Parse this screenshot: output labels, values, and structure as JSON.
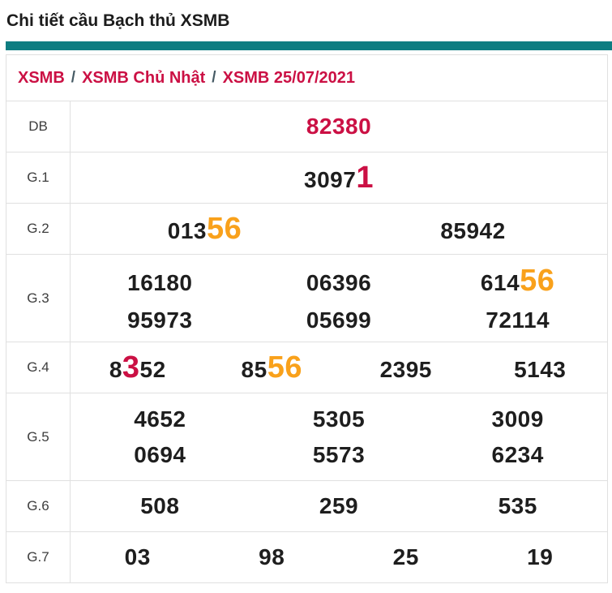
{
  "page": {
    "title": "Chi tiết cầu Bạch thủ XSMB"
  },
  "breadcrumb": {
    "separator": "/",
    "items": [
      {
        "label": "XSMB"
      },
      {
        "label": "XSMB Chủ Nhật"
      },
      {
        "label": "XSMB 25/07/2021"
      }
    ]
  },
  "colors": {
    "accent_teal": "#0e7d81",
    "crimson": "#cb1044",
    "orange": "#f9a11b",
    "text_dark": "#1e1e1e",
    "label_gray": "#3d3d3d",
    "border": "#e0e0e0",
    "separator_gray": "#455a64"
  },
  "results_table": {
    "rows": [
      {
        "label": "DB",
        "lines": [
          [
            [
              {
                "t": "82380",
                "c": "crimson"
              }
            ]
          ]
        ]
      },
      {
        "label": "G.1",
        "lines": [
          [
            [
              {
                "t": "3097"
              },
              {
                "t": "1",
                "c": "crimson",
                "big": true
              }
            ]
          ]
        ]
      },
      {
        "label": "G.2",
        "lines": [
          [
            [
              {
                "t": "013"
              },
              {
                "t": "56",
                "c": "orange",
                "big": true
              }
            ],
            [
              {
                "t": "85942"
              }
            ]
          ]
        ]
      },
      {
        "label": "G.3",
        "lines": [
          [
            [
              {
                "t": "16180"
              }
            ],
            [
              {
                "t": "06396"
              }
            ],
            [
              {
                "t": "614"
              },
              {
                "t": "56",
                "c": "orange",
                "big": true
              }
            ]
          ],
          [
            [
              {
                "t": "95973"
              }
            ],
            [
              {
                "t": "05699"
              }
            ],
            [
              {
                "t": "72114"
              }
            ]
          ]
        ]
      },
      {
        "label": "G.4",
        "lines": [
          [
            [
              {
                "t": "8"
              },
              {
                "t": "3",
                "c": "crimson",
                "big": true
              },
              {
                "t": "52"
              }
            ],
            [
              {
                "t": "85"
              },
              {
                "t": "56",
                "c": "orange",
                "big": true
              }
            ],
            [
              {
                "t": "2395"
              }
            ],
            [
              {
                "t": "5143"
              }
            ]
          ]
        ]
      },
      {
        "label": "G.5",
        "lines": [
          [
            [
              {
                "t": "4652"
              }
            ],
            [
              {
                "t": "5305"
              }
            ],
            [
              {
                "t": "3009"
              }
            ]
          ],
          [
            [
              {
                "t": "0694"
              }
            ],
            [
              {
                "t": "5573"
              }
            ],
            [
              {
                "t": "6234"
              }
            ]
          ]
        ]
      },
      {
        "label": "G.6",
        "lines": [
          [
            [
              {
                "t": "508"
              }
            ],
            [
              {
                "t": "259"
              }
            ],
            [
              {
                "t": "535"
              }
            ]
          ]
        ]
      },
      {
        "label": "G.7",
        "lines": [
          [
            [
              {
                "t": "03"
              }
            ],
            [
              {
                "t": "98"
              }
            ],
            [
              {
                "t": "25"
              }
            ],
            [
              {
                "t": "19"
              }
            ]
          ]
        ]
      }
    ]
  }
}
